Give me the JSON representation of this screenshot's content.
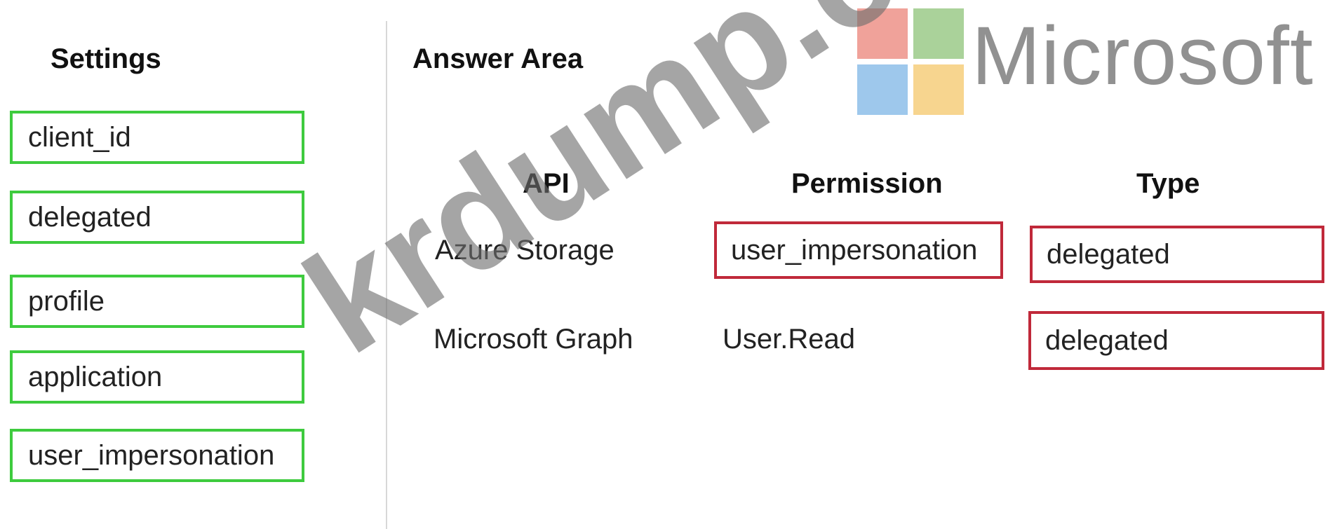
{
  "settings": {
    "heading": "Settings",
    "items": [
      {
        "label": "client_id"
      },
      {
        "label": "delegated"
      },
      {
        "label": "profile"
      },
      {
        "label": "application"
      },
      {
        "label": "user_impersonation"
      }
    ]
  },
  "answer_area": {
    "heading": "Answer Area",
    "columns": [
      "API",
      "Permission",
      "Type"
    ],
    "rows": [
      {
        "api": "Azure Storage",
        "permission": "user_impersonation",
        "type": "delegated"
      },
      {
        "api": "Microsoft Graph",
        "permission": "User.Read",
        "type": "delegated"
      }
    ]
  },
  "branding": {
    "logo_text": "Microsoft",
    "logo_colors": [
      "#f0a29a",
      "#aad29a",
      "#9ec8ec",
      "#f7d58f"
    ],
    "watermark": "krdump.com"
  },
  "colors": {
    "settings_border": "#3ecb3e",
    "answer_border": "#c0293a"
  }
}
